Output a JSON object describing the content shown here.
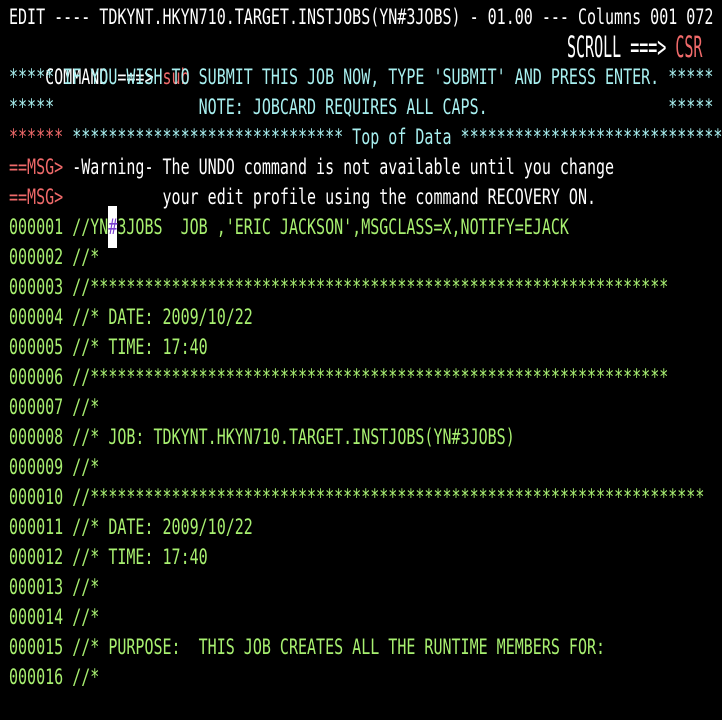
{
  "colors": {
    "white": "#ffffff",
    "red": "#f06a6a",
    "cyan": "#a8f0f0",
    "green": "#a8f070"
  },
  "header": {
    "title_line": "EDIT ---- TDKYNT.HKYN710.TARGET.INSTJOBS(YN#3JOBS) - 01.00 --- Columns 001 072",
    "command_label": "COMMAND ===> ",
    "command_value": "sub",
    "scroll_label": "SCROLL ===> ",
    "scroll_value": "CSR"
  },
  "notes": [
    "***** IF YOU WISH TO SUBMIT THIS JOB NOW, TYPE 'SUBMIT' AND PRESS ENTER. *****",
    "*****                NOTE: JOBCARD REQUIRES ALL CAPS.                    *****"
  ],
  "top_of_data": {
    "prefix": "******",
    "text": " ****************************** Top of Data ******************************"
  },
  "messages": [
    {
      "prefix": "==MSG>",
      "text": " -Warning- The UNDO command is not available until you change"
    },
    {
      "prefix": "==MSG>",
      "text": "           your edit profile using the command RECOVERY ON."
    }
  ],
  "cursor": {
    "line": "000001",
    "column": 12
  },
  "source_lines": [
    {
      "num": "000001",
      "text": "//YN#3JOBS  JOB ,'ERIC JACKSON',MSGCLASS=X,NOTIFY=EJACK"
    },
    {
      "num": "000002",
      "text": "//*"
    },
    {
      "num": "000003",
      "text": "//****************************************************************"
    },
    {
      "num": "000004",
      "text": "//* DATE: 2009/10/22"
    },
    {
      "num": "000005",
      "text": "//* TIME: 17:40"
    },
    {
      "num": "000006",
      "text": "//****************************************************************"
    },
    {
      "num": "000007",
      "text": "//*"
    },
    {
      "num": "000008",
      "text": "//* JOB: TDKYNT.HKYN710.TARGET.INSTJOBS(YN#3JOBS)"
    },
    {
      "num": "000009",
      "text": "//*"
    },
    {
      "num": "000010",
      "text": "//********************************************************************"
    },
    {
      "num": "000011",
      "text": "//* DATE: 2009/10/22"
    },
    {
      "num": "000012",
      "text": "//* TIME: 17:40"
    },
    {
      "num": "000013",
      "text": "//*"
    },
    {
      "num": "000014",
      "text": "//*"
    },
    {
      "num": "000015",
      "text": "//* PURPOSE:  THIS JOB CREATES ALL THE RUNTIME MEMBERS FOR:"
    },
    {
      "num": "000016",
      "text": "//*"
    }
  ]
}
